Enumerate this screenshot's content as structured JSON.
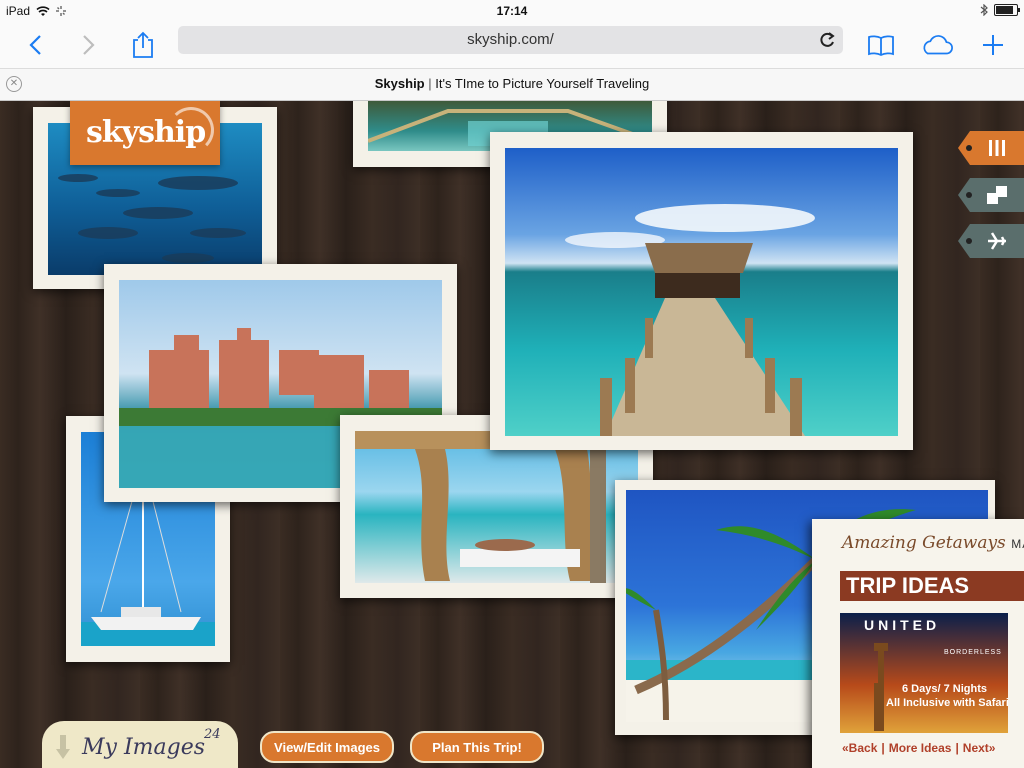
{
  "status": {
    "device": "iPad",
    "time": "17:14",
    "battery_level": 0.85
  },
  "browser": {
    "url": "skyship.com/",
    "tab_title_site": "Skyship",
    "tab_title_rest": "It's TIme to Picture Yourself Traveling"
  },
  "page": {
    "logo_text": "skyship",
    "bottom": {
      "my_images_label": "My Images",
      "my_images_count": "24",
      "view_edit_label": "View/Edit Images",
      "plan_trip_label": "Plan This Trip!"
    },
    "magazine": {
      "title": "Amazing Getaways",
      "title_suffix": "MAGAZIN",
      "section": "TRIP IDEAS",
      "ad": {
        "brand": "UNITED",
        "tagline": "BORDERLESS",
        "offer_line1": "6 Days/ 7 Nights",
        "offer_line2": "All Inclusive with Safari"
      },
      "nav": {
        "back": "«Back",
        "more": "More Ideas",
        "next": "Next»"
      }
    },
    "tags": [
      "menu-tag",
      "layout-tag",
      "flight-tag"
    ]
  },
  "colors": {
    "orange": "#d9782e",
    "tag_gray": "#5a6e6c",
    "magazine_red": "#8b3a22"
  }
}
